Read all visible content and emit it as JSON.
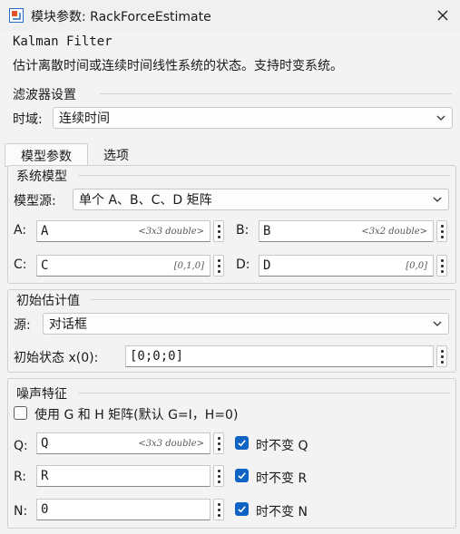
{
  "window": {
    "title": "模块参数: RackForceEstimate",
    "app_icon": "simulink-block-icon",
    "close_icon": "close-icon"
  },
  "block": {
    "name": "Kalman Filter",
    "description": "估计离散时间或连续时间线性系统的状态。支持时变系统。"
  },
  "filter_settings": {
    "title": "滤波器设置",
    "time_domain_label": "时域:",
    "time_domain_value": "连续时间"
  },
  "tabs": [
    {
      "label": "模型参数",
      "active": true
    },
    {
      "label": "选项",
      "active": false
    }
  ],
  "system_model": {
    "title": "系统模型",
    "source_label": "模型源:",
    "source_value": "单个 A、B、C、D 矩阵",
    "A": {
      "label": "A:",
      "value": "A",
      "hint": "<3x3 double>"
    },
    "B": {
      "label": "B:",
      "value": "B",
      "hint": "<3x2 double>"
    },
    "C": {
      "label": "C:",
      "value": "C",
      "hint": "[0,1,0]"
    },
    "D": {
      "label": "D:",
      "value": "D",
      "hint": "[0,0]"
    }
  },
  "initial_estimate": {
    "title": "初始估计值",
    "source_label": "源:",
    "source_value": "对话框",
    "state_label": "初始状态 x(0):",
    "state_value": "[0;0;0]"
  },
  "noise": {
    "title": "噪声特征",
    "use_gh_label": "使用 G 和 H 矩阵(默认 G=I，H=0)",
    "use_gh_checked": false,
    "Q": {
      "label": "Q:",
      "value": "Q",
      "hint": "<3x3 double>",
      "tinv_label": "时不变 Q",
      "tinv_checked": true
    },
    "R": {
      "label": "R:",
      "value": "R",
      "hint": "",
      "tinv_label": "时不变 R",
      "tinv_checked": true
    },
    "N": {
      "label": "N:",
      "value": "0",
      "hint": "",
      "tinv_label": "时不变 N",
      "tinv_checked": true
    }
  },
  "colors": {
    "accent": "#0e63c4",
    "background": "#f3f3f3"
  }
}
